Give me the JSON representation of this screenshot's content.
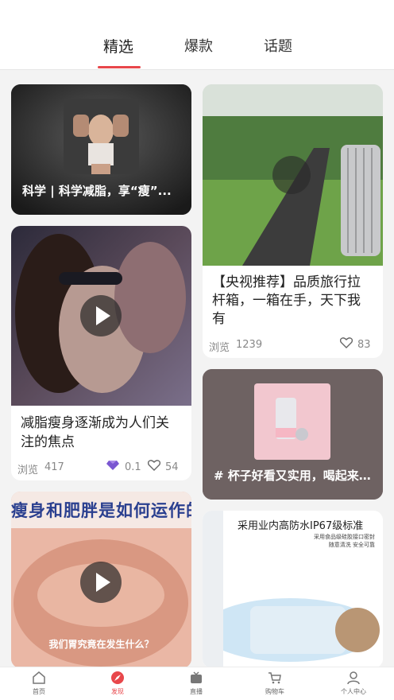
{
  "tabs": [
    "精选",
    "爆款",
    "话题"
  ],
  "cards": {
    "c1": {
      "title": "科学 | 科学减脂，享“瘦”..."
    },
    "c2": {
      "title": "减脂瘦身逐渐成为人们关注的焦点",
      "views_label": "浏览",
      "views": "417",
      "diamonds": "0.1",
      "likes": "54"
    },
    "c3": {
      "title": "瘦身和肥胖是如何运作的消化的",
      "video_caption": "我们胃究竟在发生什么？"
    },
    "c4": {
      "title": "【央视推荐】品质旅行拉杆箱，一箱在手，天下我有",
      "views_label": "浏览",
      "views": "1239",
      "likes": "83"
    },
    "c5": {
      "title": "# 杯子好看又实用，喝起来..."
    },
    "c6": {
      "headline": "采用业内高防水IP67级标准",
      "sub1": "采用食品级硅胶接口密封",
      "sub2": "随意清洗 安全可靠"
    }
  },
  "bottom_nav": [
    {
      "label": "首页",
      "icon": "home-icon"
    },
    {
      "label": "发现",
      "icon": "discover-icon",
      "active": true
    },
    {
      "label": "直播",
      "icon": "live-icon"
    },
    {
      "label": "购物车",
      "icon": "cart-icon"
    },
    {
      "label": "个人中心",
      "icon": "profile-icon"
    }
  ],
  "colors": {
    "accent": "#e8474b",
    "background": "#f3f3f3"
  }
}
